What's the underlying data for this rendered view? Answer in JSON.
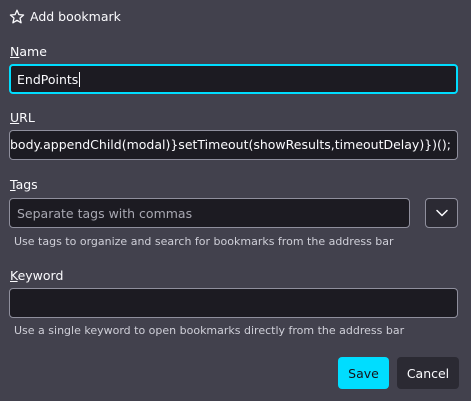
{
  "dialog": {
    "title": "Add bookmark",
    "icon": "star-outline-icon"
  },
  "name_field": {
    "label_access_key": "N",
    "label_rest": "ame",
    "value": "EndPoints"
  },
  "url_field": {
    "label_access_key": "U",
    "label_rest": "RL",
    "value": "),document.body.appendChild(modal)}setTimeout(showResults,timeoutDelay)})();"
  },
  "tags_field": {
    "label_access_key": "T",
    "label_rest": "ags",
    "placeholder": "Separate tags with commas",
    "hint": "Use tags to organize and search for bookmarks from the address bar",
    "toggle_icon": "chevron-down-icon"
  },
  "keyword_field": {
    "label_access_key": "K",
    "label_rest": "eyword",
    "value": "",
    "hint": "Use a single keyword to open bookmarks directly from the address bar"
  },
  "buttons": {
    "save": "Save",
    "cancel": "Cancel"
  },
  "colors": {
    "background": "#42414d",
    "field_background": "#1c1b22",
    "accent": "#00ddff",
    "text": "#fbfbfe"
  }
}
